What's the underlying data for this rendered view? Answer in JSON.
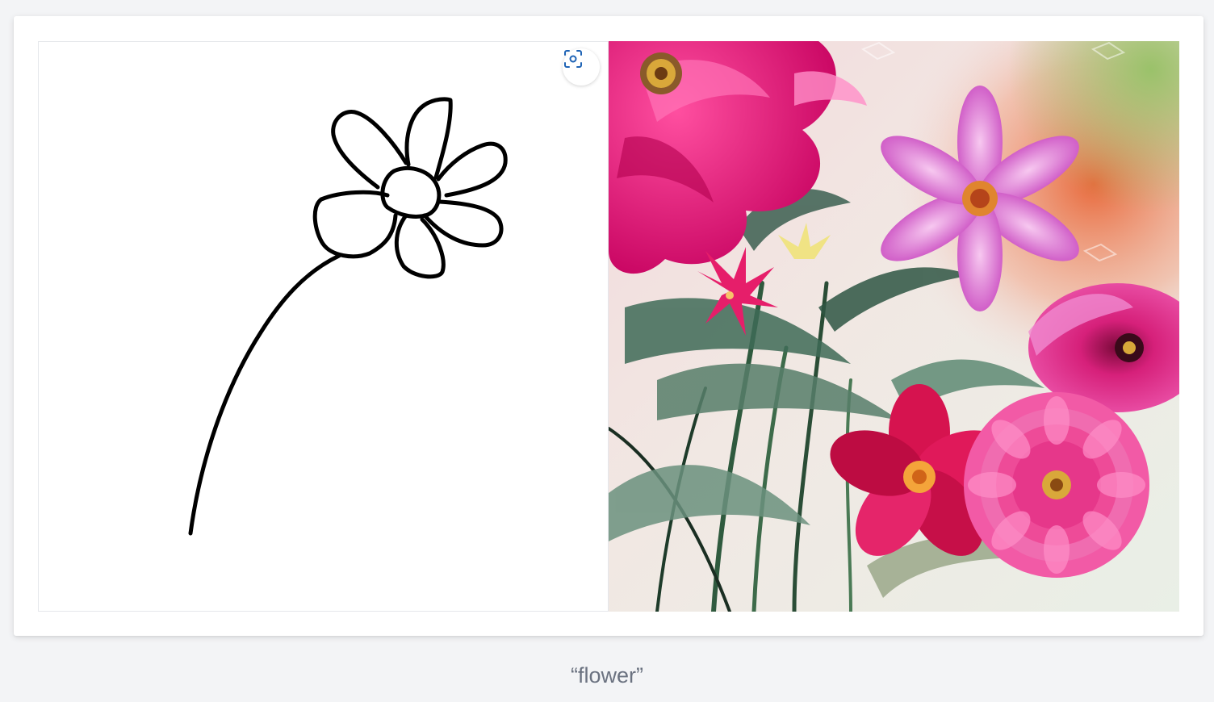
{
  "caption": "“flower”",
  "toolbar": {
    "focus_icon": "focus-camera-icon"
  },
  "colors": {
    "page_background": "#f3f4f6",
    "card_background": "#ffffff",
    "stroke": "#000000",
    "accent_icon": "#1e63b5",
    "caption_text": "#6b7280"
  }
}
